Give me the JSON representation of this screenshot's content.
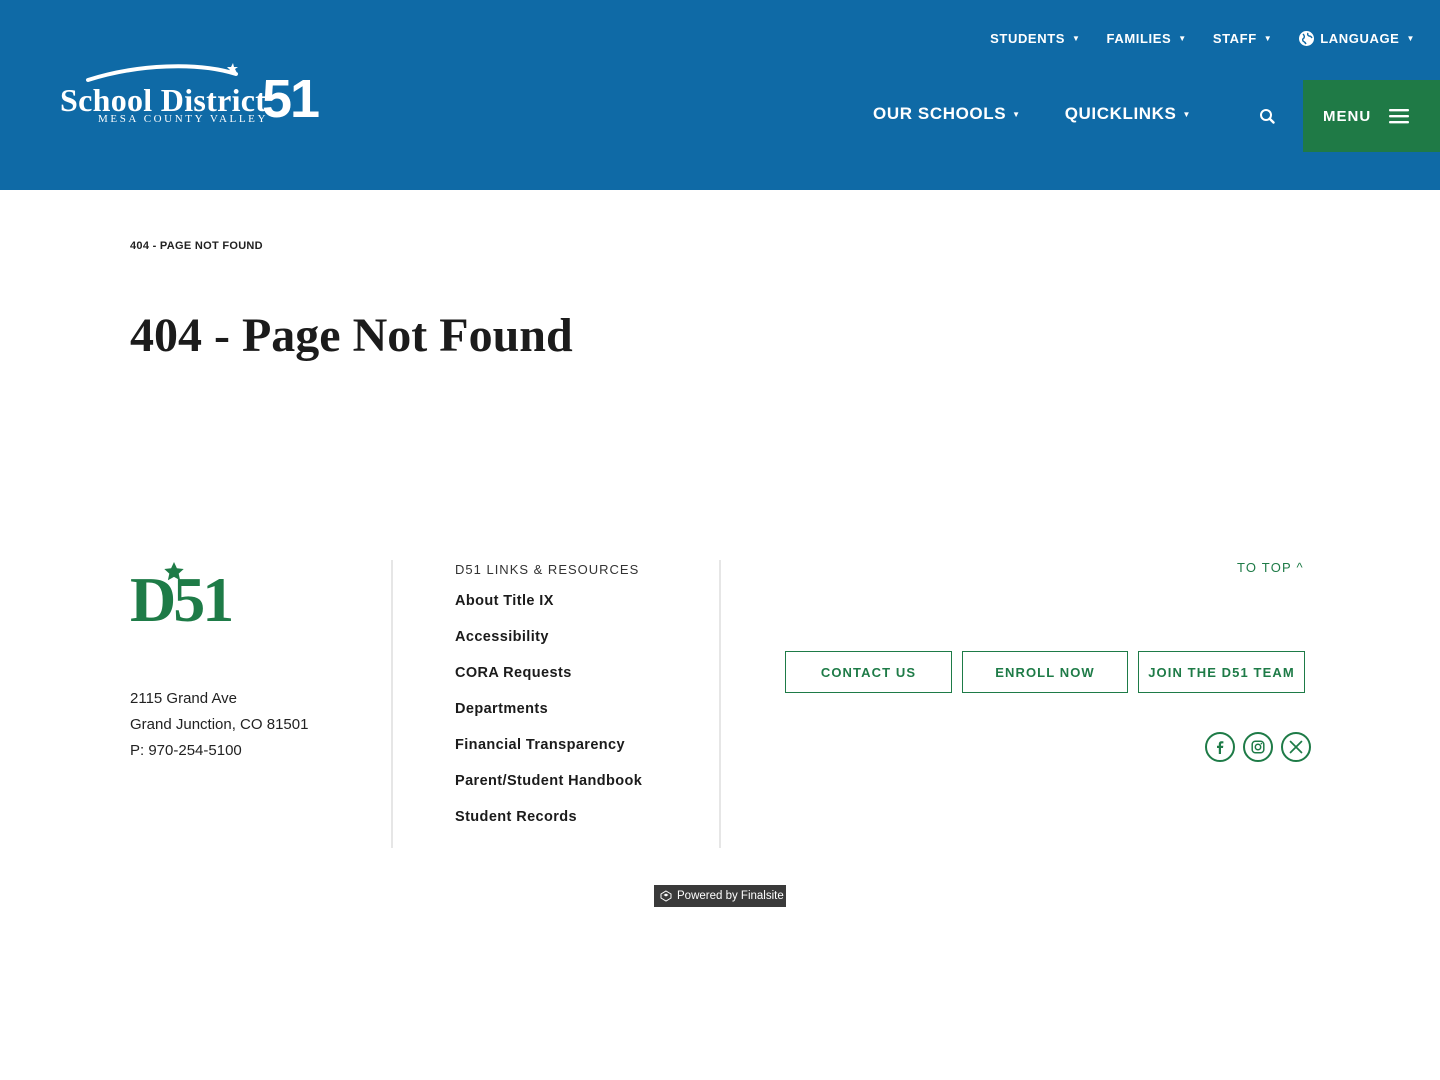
{
  "header": {
    "logo": {
      "script_text": "School District",
      "number": "51",
      "subtitle": "MESA COUNTY VALLEY"
    },
    "utility_nav": [
      {
        "label": "STUDENTS"
      },
      {
        "label": "FAMILIES"
      },
      {
        "label": "STAFF"
      },
      {
        "label": "LANGUAGE"
      }
    ],
    "main_nav": [
      {
        "label": "OUR SCHOOLS"
      },
      {
        "label": "QUICKLINKS"
      }
    ],
    "menu_label": "MENU",
    "colors": {
      "header_bg": "#0f6aa6",
      "menu_bg": "#1f7a46"
    }
  },
  "content": {
    "breadcrumb": "404 - PAGE NOT FOUND",
    "title": "404 - Page Not Found"
  },
  "footer": {
    "logo_text": "D51",
    "address": {
      "line1": "2115 Grand Ave",
      "line2": "Grand Junction, CO  81501",
      "phone": "P: 970-254-5100"
    },
    "links_heading": "D51 LINKS & RESOURCES",
    "links": [
      "About Title IX",
      "Accessibility",
      "CORA Requests",
      "Departments",
      "Financial Transparency",
      "Parent/Student Handbook",
      "Student Records"
    ],
    "to_top": "TO TOP ^",
    "cta_buttons": [
      "CONTACT US",
      "ENROLL NOW",
      "JOIN THE D51 TEAM"
    ],
    "social_icons": [
      "facebook-icon",
      "instagram-icon",
      "x-icon"
    ],
    "powered_by": "Powered by Finalsite",
    "colors": {
      "accent_green": "#1e7b47"
    }
  }
}
